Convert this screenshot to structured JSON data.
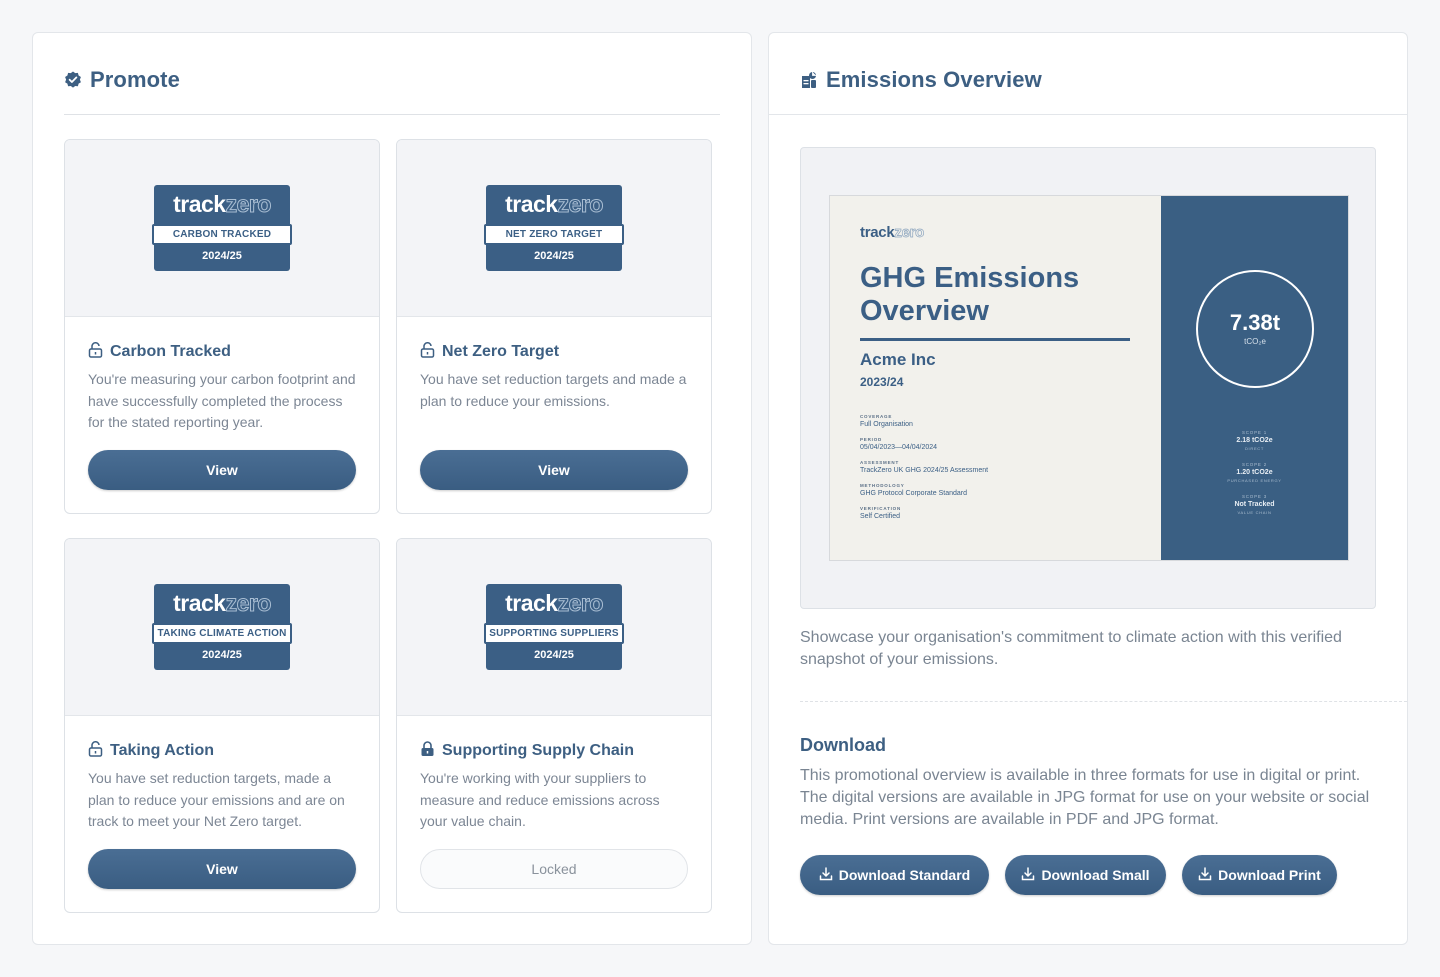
{
  "promote": {
    "title": "Promote",
    "cards": [
      {
        "badge_brand_track": "track",
        "badge_brand_zero": "zero",
        "badge_label": "CARBON TRACKED",
        "badge_year": "2024/25",
        "title": "Carbon Tracked",
        "description": "You're measuring your carbon footprint and have successfully completed the process for the stated reporting year.",
        "button": "View",
        "locked": false,
        "lock_icon": "lock-open-icon"
      },
      {
        "badge_brand_track": "track",
        "badge_brand_zero": "zero",
        "badge_label": "NET ZERO TARGET",
        "badge_year": "2024/25",
        "title": "Net Zero Target",
        "description": "You have set reduction targets and made a plan to reduce your emissions.",
        "button": "View",
        "locked": false,
        "lock_icon": "lock-open-icon"
      },
      {
        "badge_brand_track": "track",
        "badge_brand_zero": "zero",
        "badge_label": "TAKING CLIMATE ACTION",
        "badge_year": "2024/25",
        "title": "Taking Action",
        "description": "You have set reduction targets, made a plan to reduce your emissions and are on track to meet your Net Zero target.",
        "button": "View",
        "locked": false,
        "lock_icon": "lock-open-icon"
      },
      {
        "badge_brand_track": "track",
        "badge_brand_zero": "zero",
        "badge_label": "SUPPORTING SUPPLIERS",
        "badge_year": "2024/25",
        "title": "Supporting Supply Chain",
        "description": "You're working with your suppliers to measure and reduce emissions across your value chain.",
        "button": "Locked",
        "locked": true,
        "lock_icon": "lock-closed-icon"
      }
    ]
  },
  "emissions": {
    "title": "Emissions Overview",
    "poster": {
      "brand_track": "track",
      "brand_zero": "zero",
      "title_line1": "GHG Emissions",
      "title_line2": "Overview",
      "org": "Acme Inc",
      "year": "2023/24",
      "meta": [
        {
          "label": "COVERAGE",
          "value": "Full Organisation"
        },
        {
          "label": "PERIOD",
          "value": "05/04/2023—04/04/2024"
        },
        {
          "label": "ASSESSMENT",
          "value": "TrackZero UK GHG 2024/25 Assessment"
        },
        {
          "label": "METHODOLOGY",
          "value": "GHG Protocol Corporate Standard"
        },
        {
          "label": "VERIFICATION",
          "value": "Self Certified"
        }
      ],
      "total_value": "7.38t",
      "total_unit": "tCO₂e",
      "scopes": [
        {
          "label": "SCOPE 1",
          "value": "2.18 tCO2e",
          "sub": "DIRECT"
        },
        {
          "label": "SCOPE 2",
          "value": "1.20 tCO2e",
          "sub": "PURCHASED ENERGY"
        },
        {
          "label": "SCOPE 3",
          "value": "Not Tracked",
          "sub": "VALUE CHAIN"
        }
      ]
    },
    "showcase_text": "Showcase your organisation's commitment to climate action with this verified snapshot of your emissions.",
    "download_title": "Download",
    "download_text": "This promotional overview is available in three formats for use in digital or print. The digital versions are available in JPG format for use on your website or social media. Print versions are available in PDF and JPG format.",
    "buttons": {
      "standard": "Download Standard",
      "small": "Download Small",
      "print": "Download Print"
    }
  },
  "colors": {
    "brand": "#3b5f85",
    "muted_text": "#7a8592",
    "panel_bg": "#ffffff",
    "page_bg": "#f6f7f9"
  }
}
